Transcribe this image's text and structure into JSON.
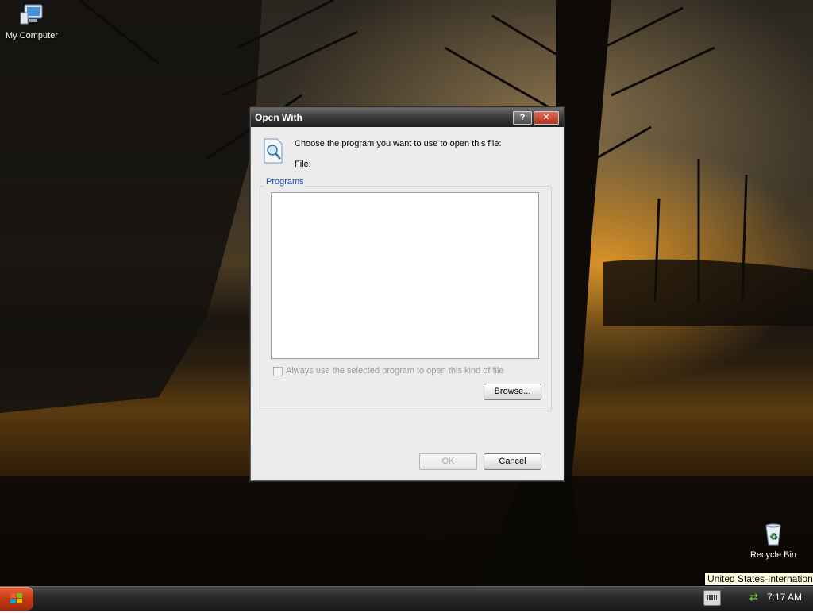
{
  "desktop": {
    "icons": [
      {
        "label": "My Computer",
        "icon": "my-computer-icon"
      },
      {
        "label": "Recycle Bin",
        "icon": "recycle-bin-icon"
      }
    ]
  },
  "dialog": {
    "title": "Open With",
    "help_button": "?",
    "close_button": "✕",
    "prompt": "Choose the program you want to use to open this file:",
    "file_label": "File:",
    "group_label": "Programs",
    "programs": [],
    "always_use_label": "Always use the selected program to open this kind of file",
    "always_use_checked": false,
    "browse_label": "Browse...",
    "ok_label": "OK",
    "cancel_label": "Cancel"
  },
  "taskbar": {
    "tooltip": "United States-International",
    "clock": "7:17 AM"
  },
  "colors": {
    "group_label": "#1a4fb5",
    "close_button": "#c0402a"
  }
}
